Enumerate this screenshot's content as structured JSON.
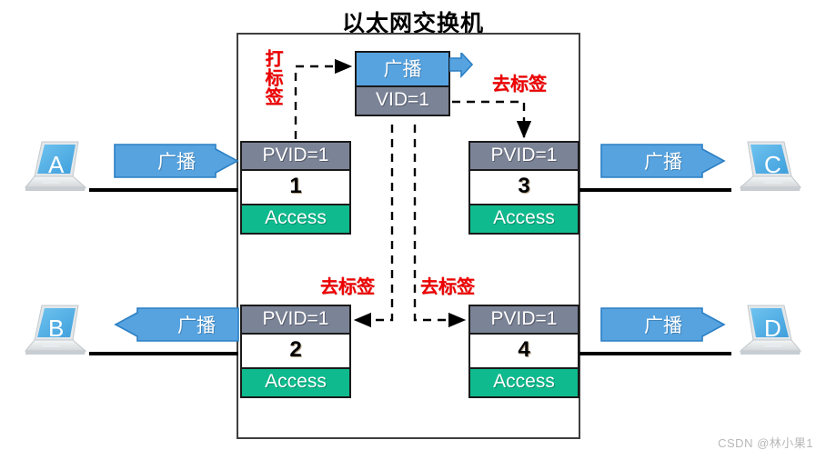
{
  "title": "以太网交换机",
  "watermark": "CSDN @林小果1",
  "colors": {
    "broadcast_blue": "#56a3e0",
    "pvid_gray": "#7b8397",
    "access_green": "#0fbb8e",
    "annotation_red": "#ee0000",
    "chassis_border": "#3f3f3f"
  },
  "frame": {
    "broadcast_label": "广播",
    "vid_label": "VID=1"
  },
  "ports": [
    {
      "id": "port-1",
      "pvid": "PVID=1",
      "number": "1",
      "mode": "Access"
    },
    {
      "id": "port-2",
      "pvid": "PVID=1",
      "number": "2",
      "mode": "Access"
    },
    {
      "id": "port-3",
      "pvid": "PVID=1",
      "number": "3",
      "mode": "Access"
    },
    {
      "id": "port-4",
      "pvid": "PVID=1",
      "number": "4",
      "mode": "Access"
    }
  ],
  "hosts": [
    {
      "id": "host-a",
      "letter": "A",
      "tag_label": "广播",
      "direction": "right"
    },
    {
      "id": "host-b",
      "letter": "B",
      "tag_label": "广播",
      "direction": "left"
    },
    {
      "id": "host-c",
      "letter": "C",
      "tag_label": "广播",
      "direction": "right"
    },
    {
      "id": "host-d",
      "letter": "D",
      "tag_label": "广播",
      "direction": "right"
    }
  ],
  "annotations": {
    "add_tag": "打标签",
    "strip_tag_top_right": "去标签",
    "strip_tag_bottom_left": "去标签",
    "strip_tag_bottom_right": "去标签"
  }
}
